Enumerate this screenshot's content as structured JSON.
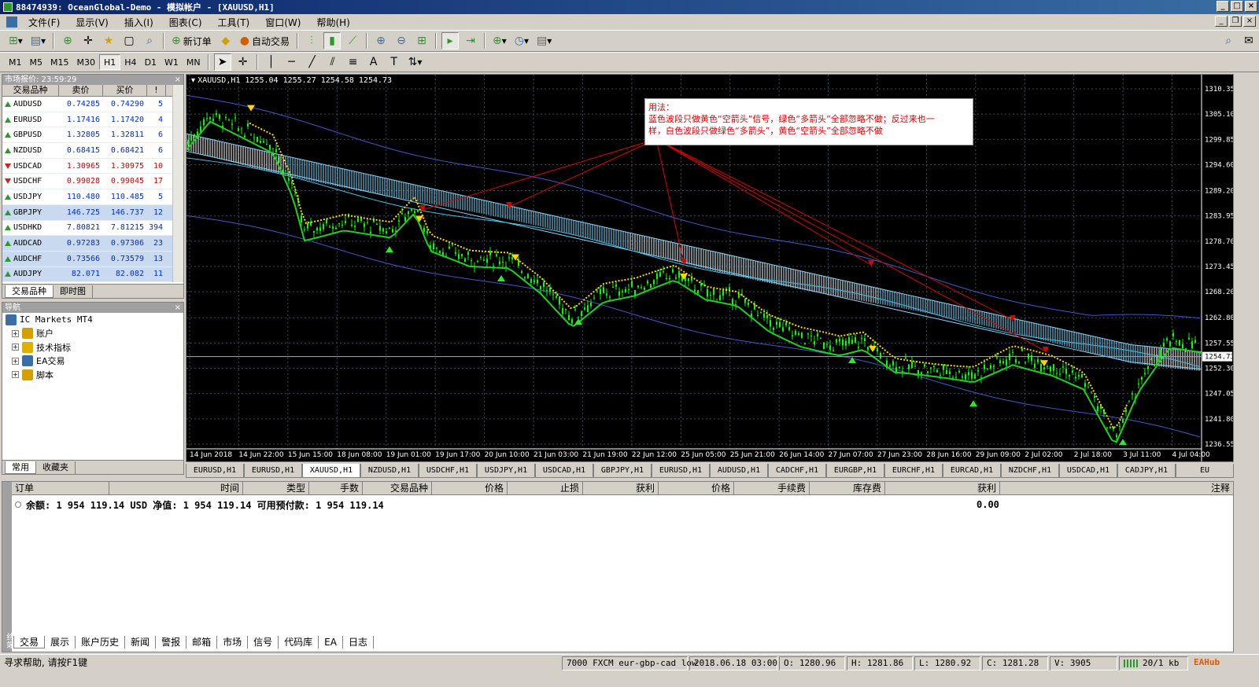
{
  "window": {
    "title": "88474939: OceanGlobal-Demo - 模拟帐户 - [XAUUSD,H1]"
  },
  "menu": [
    "文件(F)",
    "显示(V)",
    "插入(I)",
    "图表(C)",
    "工具(T)",
    "窗口(W)",
    "帮助(H)"
  ],
  "toolbar": {
    "new_order": "新订单",
    "auto_trade": "自动交易"
  },
  "timeframes": [
    "M1",
    "M5",
    "M15",
    "M30",
    "H1",
    "H4",
    "D1",
    "W1",
    "MN"
  ],
  "active_timeframe": "H1",
  "market_watch": {
    "title": "市场报价: 23:59:29",
    "headers": [
      "交易品种",
      "卖价",
      "买价",
      "!"
    ],
    "rows": [
      {
        "symbol": "AUDUSD",
        "bid": "0.74285",
        "ask": "0.74290",
        "spread": "5",
        "dir": "up",
        "color": "blue",
        "sel": false
      },
      {
        "symbol": "EURUSD",
        "bid": "1.17416",
        "ask": "1.17420",
        "spread": "4",
        "dir": "up",
        "color": "blue",
        "sel": false
      },
      {
        "symbol": "GBPUSD",
        "bid": "1.32805",
        "ask": "1.32811",
        "spread": "6",
        "dir": "up",
        "color": "blue",
        "sel": false
      },
      {
        "symbol": "NZDUSD",
        "bid": "0.68415",
        "ask": "0.68421",
        "spread": "6",
        "dir": "up",
        "color": "blue",
        "sel": false
      },
      {
        "symbol": "USDCAD",
        "bid": "1.30965",
        "ask": "1.30975",
        "spread": "10",
        "dir": "down",
        "color": "red",
        "sel": false
      },
      {
        "symbol": "USDCHF",
        "bid": "0.99028",
        "ask": "0.99045",
        "spread": "17",
        "dir": "down",
        "color": "red",
        "sel": false
      },
      {
        "symbol": "USDJPY",
        "bid": "110.480",
        "ask": "110.485",
        "spread": "5",
        "dir": "up",
        "color": "blue",
        "sel": false
      },
      {
        "symbol": "GBPJPY",
        "bid": "146.725",
        "ask": "146.737",
        "spread": "12",
        "dir": "up",
        "color": "blue",
        "sel": true
      },
      {
        "symbol": "USDHKD",
        "bid": "7.80821",
        "ask": "7.81215",
        "spread": "394",
        "dir": "up",
        "color": "blue",
        "sel": false
      },
      {
        "symbol": "AUDCAD",
        "bid": "0.97283",
        "ask": "0.97306",
        "spread": "23",
        "dir": "up",
        "color": "blue",
        "sel": true
      },
      {
        "symbol": "AUDCHF",
        "bid": "0.73566",
        "ask": "0.73579",
        "spread": "13",
        "dir": "up",
        "color": "blue",
        "sel": true
      },
      {
        "symbol": "AUDJPY",
        "bid": "82.071",
        "ask": "82.082",
        "spread": "11",
        "dir": "up",
        "color": "blue",
        "sel": true
      }
    ],
    "tabs": [
      "交易品种",
      "即时图"
    ]
  },
  "navigator": {
    "title": "导航",
    "root": "IC Markets MT4",
    "items": [
      "账户",
      "技术指标",
      "EA交易",
      "脚本"
    ],
    "tabs": [
      "常用",
      "收藏夹"
    ]
  },
  "chart": {
    "header": "XAUUSD,H1  1255.04 1255.27 1254.58 1254.73",
    "price_labels": [
      "1310.35",
      "1305.10",
      "1299.85",
      "1294.60",
      "1289.20",
      "1283.95",
      "1278.70",
      "1273.45",
      "1268.20",
      "1262.80",
      "1257.55",
      "1252.30",
      "1247.05",
      "1241.80",
      "1236.55"
    ],
    "current_price": "1254.73",
    "time_labels": [
      "14 Jun 2018",
      "14 Jun 22:00",
      "15 Jun 15:00",
      "18 Jun 08:00",
      "19 Jun 01:00",
      "19 Jun 17:00",
      "20 Jun 10:00",
      "21 Jun 03:00",
      "21 Jun 19:00",
      "22 Jun 12:00",
      "25 Jun 05:00",
      "25 Jun 21:00",
      "26 Jun 14:00",
      "27 Jun 07:00",
      "27 Jun 23:00",
      "28 Jun 16:00",
      "29 Jun 09:00",
      "2 Jul 02:00",
      "2 Jul 18:00",
      "3 Jul 11:00",
      "4 Jul 04:00"
    ],
    "annotation": {
      "line1": "用法：",
      "line2": "蓝色波段只做黄色“空箭头”信号，绿色“多箭头”全部忽略不做；反过来也一",
      "line3": "样，白色波段只做绿色“多箭头”，黄色“空箭头”全部忽略不做"
    },
    "colors": {
      "candle": "#00ff00",
      "signal_line": "#ffd700",
      "band_blue": "#7fd8ff",
      "annotation_text": "#e00000",
      "grid": "#3a4a5a"
    }
  },
  "chart_tabs": [
    "EURUSD,H1",
    "EURUSD,H1",
    "XAUUSD,H1",
    "NZDUSD,H1",
    "USDCHF,H1",
    "USDJPY,H1",
    "USDCAD,H1",
    "GBPJPY,H1",
    "EURUSD,H1",
    "AUDUSD,H1",
    "CADCHF,H1",
    "EURGBP,H1",
    "EURCHF,H1",
    "EURCAD,H1",
    "NZDCHF,H1",
    "USDCAD,H1",
    "CADJPY,H1",
    "EU"
  ],
  "terminal": {
    "headers": [
      "订单",
      "时间",
      "类型",
      "手数",
      "交易品种",
      "价格",
      "止损",
      "获利",
      "价格",
      "手续费",
      "库存费",
      "获利",
      "注释"
    ],
    "balance_text": "余额: 1 954 119.14 USD  净值: 1 954 119.14  可用预付款: 1 954 119.14",
    "profit": "0.00",
    "tabs": [
      "交易",
      "展示",
      "账户历史",
      "新闻",
      "警报",
      "邮箱",
      "市场",
      "信号",
      "代码库",
      "EA",
      "日志"
    ],
    "side_label": "终端"
  },
  "status": {
    "help": "寻求帮助, 请按F1键",
    "profile": "7000 FXCM eur-gbp-cad low",
    "datetime": "2018.06.18 03:00",
    "open": "O: 1280.96",
    "high": "H: 1281.86",
    "low": "L: 1280.92",
    "close": "C: 1281.28",
    "volume": "V: 3905",
    "traffic": "20/1 kb",
    "brand": "EAHub"
  }
}
